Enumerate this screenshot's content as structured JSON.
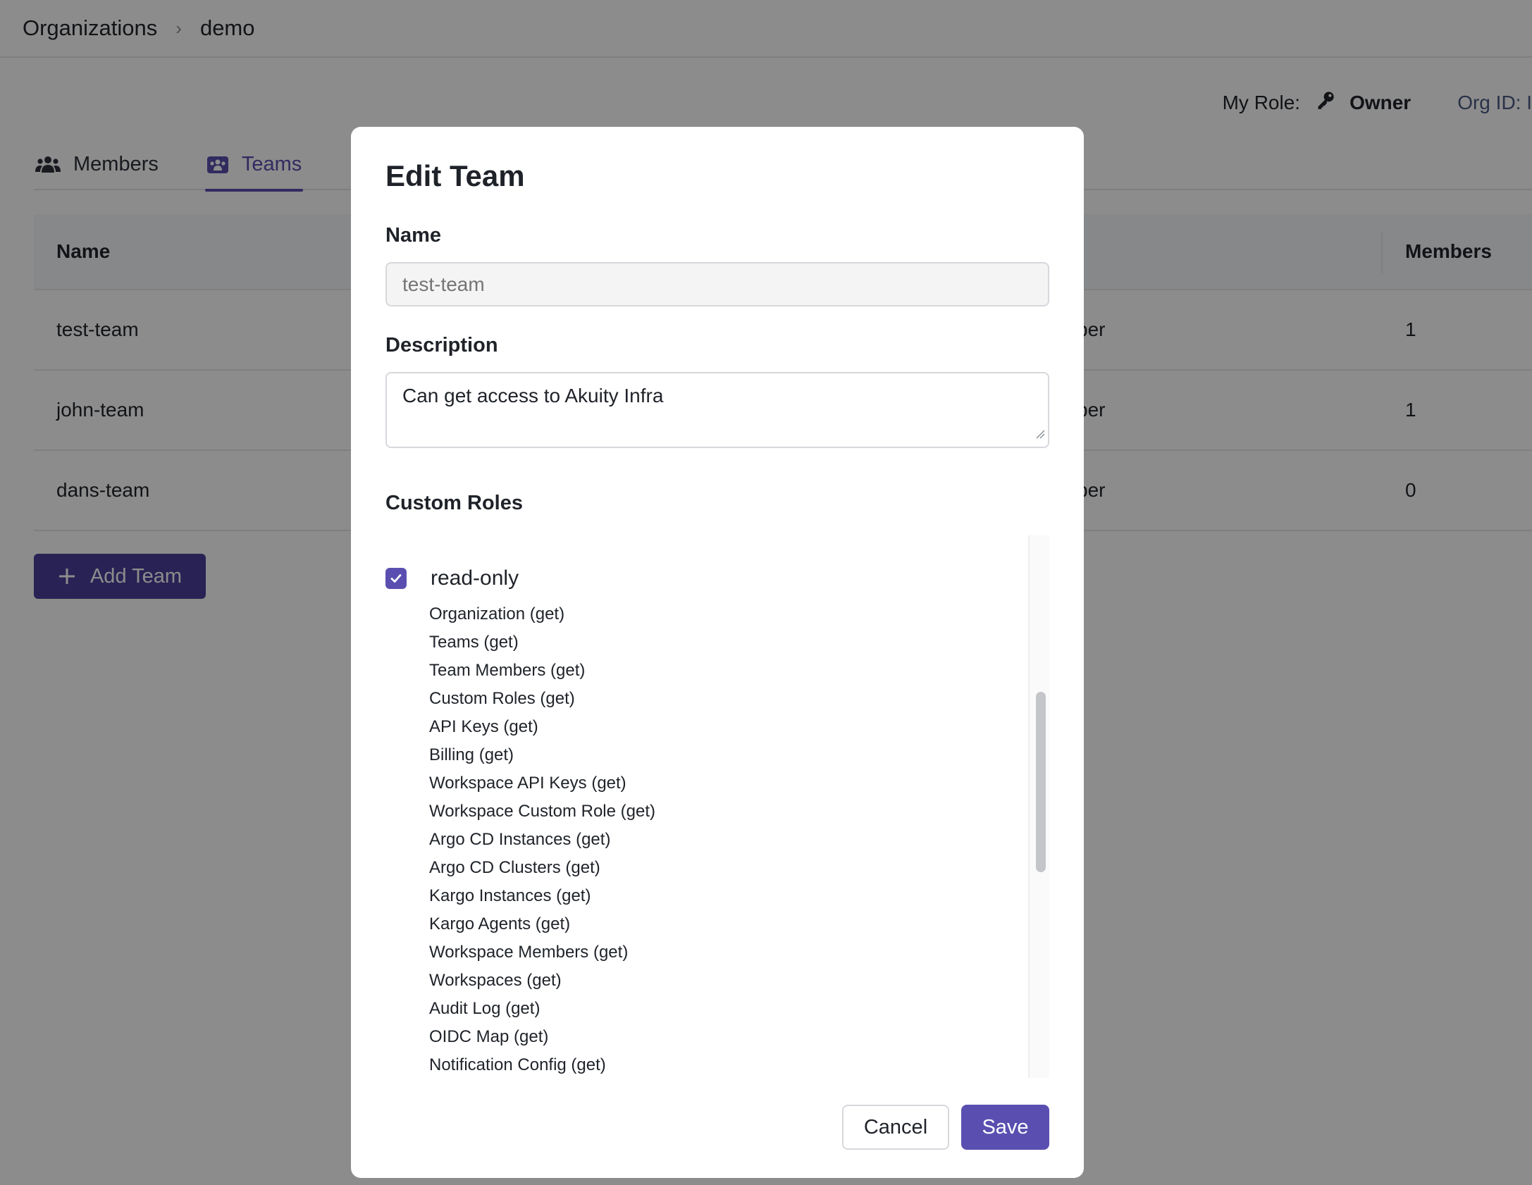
{
  "breadcrumb": {
    "root": "Organizations",
    "separator": "›",
    "current": "demo"
  },
  "header": {
    "role_label": "My Role:",
    "role_value": "Owner",
    "org_id_label": "Org ID: I"
  },
  "tabs": [
    {
      "label": "Members",
      "icon": "users-icon"
    },
    {
      "label": "Teams",
      "icon": "teams-icon",
      "active": true
    }
  ],
  "table": {
    "headers": {
      "name": "Name",
      "members": "Members"
    },
    "rows": [
      {
        "name": "test-team",
        "role": "ber",
        "members": "1"
      },
      {
        "name": "john-team",
        "role": "ber",
        "members": "1"
      },
      {
        "name": "dans-team",
        "role": "ber",
        "members": "0"
      }
    ],
    "add_button": "Add Team"
  },
  "modal": {
    "title": "Edit Team",
    "name_label": "Name",
    "name_placeholder": "test-team",
    "description_label": "Description",
    "description_value": "Can get access to Akuity Infra",
    "custom_roles_label": "Custom Roles",
    "role": {
      "name": "read-only",
      "checked": true,
      "permissions": [
        "Organization (get)",
        "Teams (get)",
        "Team Members (get)",
        "Custom Roles (get)",
        "API Keys (get)",
        "Billing (get)",
        "Workspace API Keys (get)",
        "Workspace Custom Role (get)",
        "Argo CD Instances (get)",
        "Argo CD Clusters (get)",
        "Kargo Instances (get)",
        "Kargo Agents (get)",
        "Workspace Members (get)",
        "Workspaces (get)",
        "Audit Log (get)",
        "OIDC Map (get)",
        "Notification Config (get)"
      ]
    },
    "cancel_label": "Cancel",
    "save_label": "Save"
  },
  "colors": {
    "accent": "#5a4fb0",
    "add_button": "#4b3f9c",
    "overlay": "rgba(0,0,0,0.45)"
  }
}
